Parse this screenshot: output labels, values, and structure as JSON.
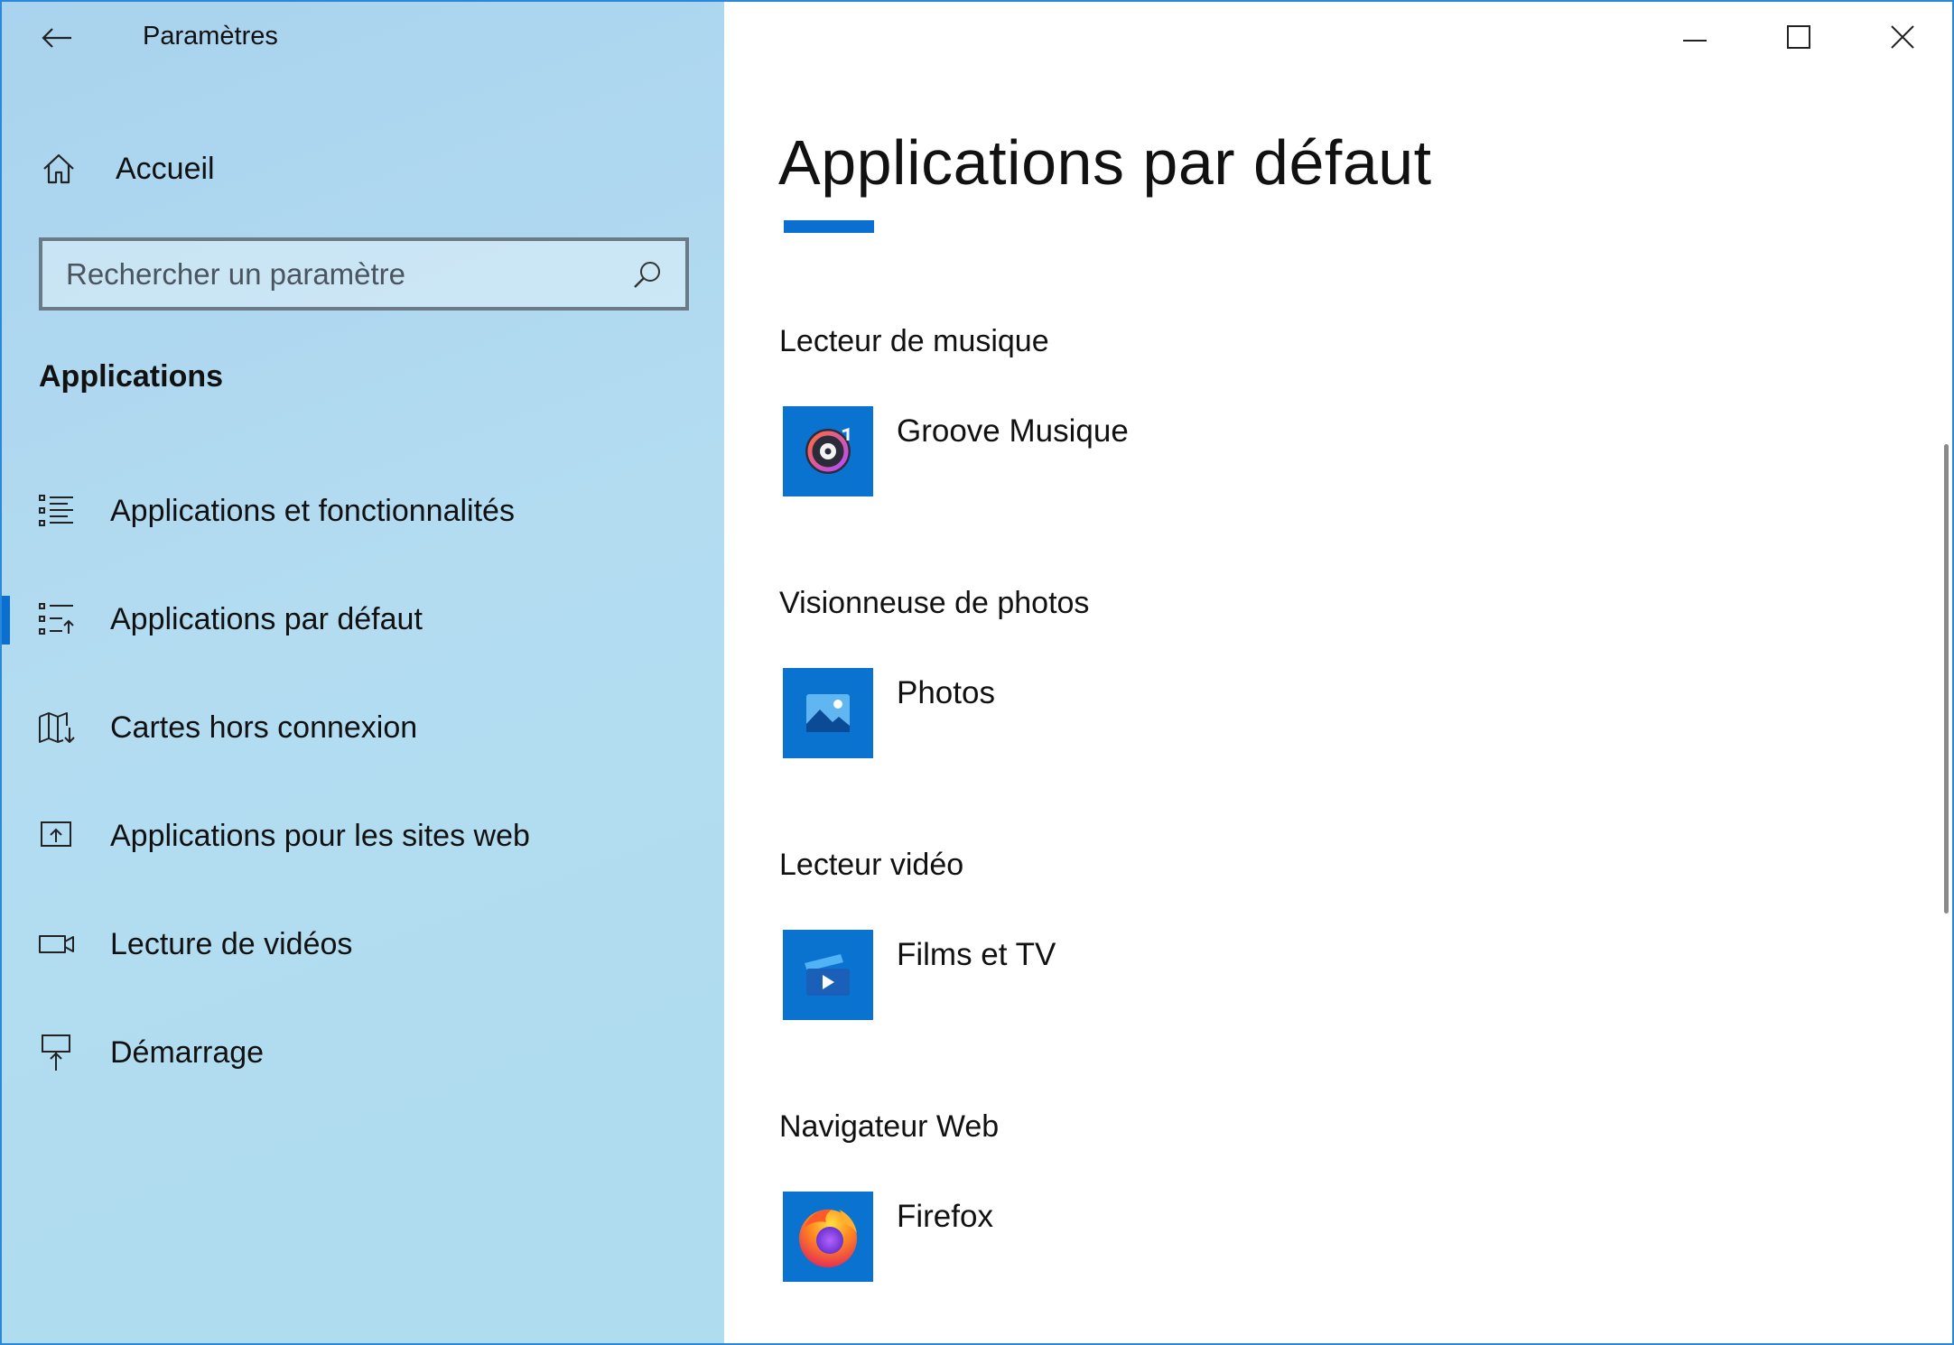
{
  "window": {
    "title": "Paramètres"
  },
  "sidebar": {
    "home_label": "Accueil",
    "search": {
      "placeholder": "Rechercher un paramètre"
    },
    "section_title": "Applications",
    "items": [
      {
        "label": "Applications et fonctionnalités",
        "icon": "apps-features-icon",
        "selected": false
      },
      {
        "label": "Applications par défaut",
        "icon": "default-apps-icon",
        "selected": true
      },
      {
        "label": "Cartes hors connexion",
        "icon": "offline-maps-icon",
        "selected": false
      },
      {
        "label": "Applications pour les sites web",
        "icon": "apps-for-websites-icon",
        "selected": false
      },
      {
        "label": "Lecture de vidéos",
        "icon": "video-playback-icon",
        "selected": false
      },
      {
        "label": "Démarrage",
        "icon": "startup-icon",
        "selected": false
      }
    ]
  },
  "main": {
    "page_title": "Applications par défaut",
    "categories": [
      {
        "label": "Lecteur de musique",
        "app": "Groove Musique",
        "icon": "groove-music-icon"
      },
      {
        "label": "Visionneuse de photos",
        "app": "Photos",
        "icon": "photos-icon"
      },
      {
        "label": "Lecteur vidéo",
        "app": "Films et TV",
        "icon": "films-tv-icon"
      },
      {
        "label": "Navigateur Web",
        "app": "Firefox",
        "icon": "firefox-icon"
      }
    ]
  },
  "colors": {
    "accent": "#0a6fd0",
    "tile": "#0a72cf",
    "sidebar_bg": "#afd9ef"
  }
}
